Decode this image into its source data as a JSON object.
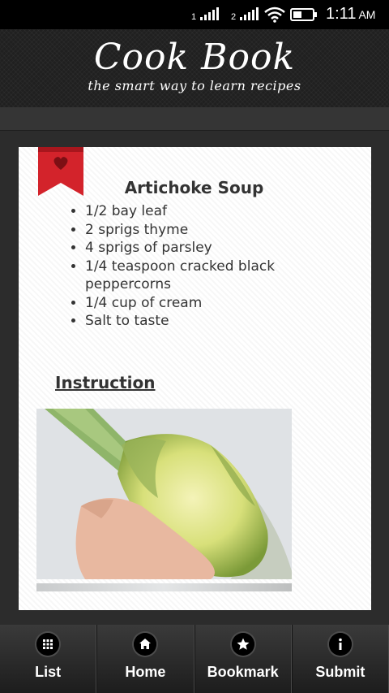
{
  "status": {
    "sim1": "1",
    "sim2": "2",
    "time": "1:11",
    "ampm": "AM"
  },
  "header": {
    "title": "Cook Book",
    "subtitle": "the smart way to learn recipes"
  },
  "recipe": {
    "title": "Artichoke Soup",
    "ingredients": [
      "1/2 bay leaf",
      "2 sprigs thyme",
      "4 sprigs of parsley",
      "1/4 teaspoon cracked black peppercorns",
      "1/4 cup of cream",
      "Salt to taste"
    ],
    "instruction_heading": "Instruction"
  },
  "nav": [
    {
      "label": "List",
      "icon": "grid-icon"
    },
    {
      "label": "Home",
      "icon": "home-icon"
    },
    {
      "label": "Bookmark",
      "icon": "star-icon"
    },
    {
      "label": "Submit",
      "icon": "info-icon"
    }
  ],
  "colors": {
    "ribbon": "#d3232b",
    "header_bg": "#202020",
    "card_bg": "#ffffff"
  }
}
